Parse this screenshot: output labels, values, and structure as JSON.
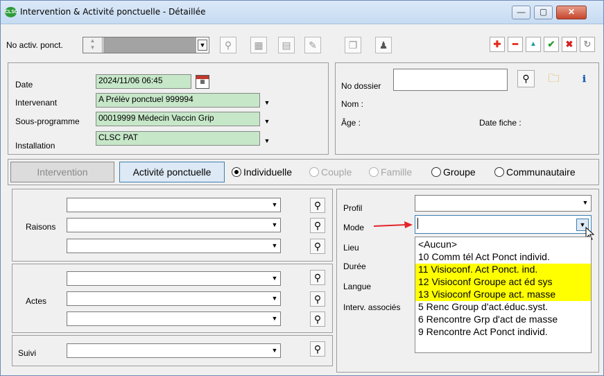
{
  "window": {
    "title": "Intervention & Activité ponctuelle - Détaillée",
    "app_icon_text": "CLSC",
    "minimize_label": "—",
    "maximize_label": "▢",
    "close_label": "✕"
  },
  "toolbar": {
    "no_activ_label": "No activ. ponct.",
    "dropdown_arrow": "▼"
  },
  "action_buttons": [
    "✚",
    "━",
    "▲",
    "✔",
    "✖",
    "↻"
  ],
  "colors": {
    "add": "#e32b1b",
    "remove": "#e32b1b",
    "up": "#14a0a0",
    "confirm": "#2a9a2a",
    "cancel": "#d42020",
    "refresh": "#9a9a9a",
    "highlight": "#ffff00",
    "green_field": "#c6e7c8"
  },
  "left_panel": {
    "date_label": "Date",
    "date_value": "2024/11/06 06:45",
    "intervenant_label": "Intervenant",
    "intervenant_value": "A Prélèv ponctuel 999994",
    "sous_programme_label": "Sous-programme",
    "sous_programme_value": "00019999 Médecin Vaccin Grip",
    "installation_label": "Installation",
    "installation_value": "CLSC PAT"
  },
  "right_panel": {
    "no_dossier_label": "No dossier",
    "no_dossier_value": "",
    "nom_label": "Nom :",
    "age_label": "Âge :",
    "date_fiche_label": "Date fiche :"
  },
  "tabs": {
    "intervention": "Intervention",
    "activite_ponctuelle": "Activité ponctuelle"
  },
  "radios": [
    {
      "label": "Individuelle",
      "checked": true,
      "disabled": false
    },
    {
      "label": "Couple",
      "checked": false,
      "disabled": true
    },
    {
      "label": "Famille",
      "checked": false,
      "disabled": true
    },
    {
      "label": "Groupe",
      "checked": false,
      "disabled": false
    },
    {
      "label": "Communautaire",
      "checked": false,
      "disabled": false
    }
  ],
  "lower_left": {
    "raisons_label": "Raisons",
    "actes_label": "Actes",
    "suivi_label": "Suivi"
  },
  "lower_right": {
    "profil_label": "Profil",
    "mode_label": "Mode",
    "mode_value": "",
    "lieu_label": "Lieu",
    "duree_label": "Durée",
    "langue_label": "Langue",
    "interv_associes_label": "Interv. associés"
  },
  "mode_options": [
    {
      "label": "<Aucun>",
      "highlighted": false
    },
    {
      "label": "10 Comm tél Act Ponct individ.",
      "highlighted": false
    },
    {
      "label": "11 Visioconf. Act Ponct. ind.",
      "highlighted": true
    },
    {
      "label": "12 Visioconf Groupe act éd sys",
      "highlighted": true
    },
    {
      "label": "13 Visioconf Groupe act. masse",
      "highlighted": true
    },
    {
      "label": "5 Renc Group d'act.éduc.syst.",
      "highlighted": false
    },
    {
      "label": "6 Rencontre Grp d'act de masse",
      "highlighted": false
    },
    {
      "label": "9 Rencontre Act Ponct individ.",
      "highlighted": false
    }
  ]
}
